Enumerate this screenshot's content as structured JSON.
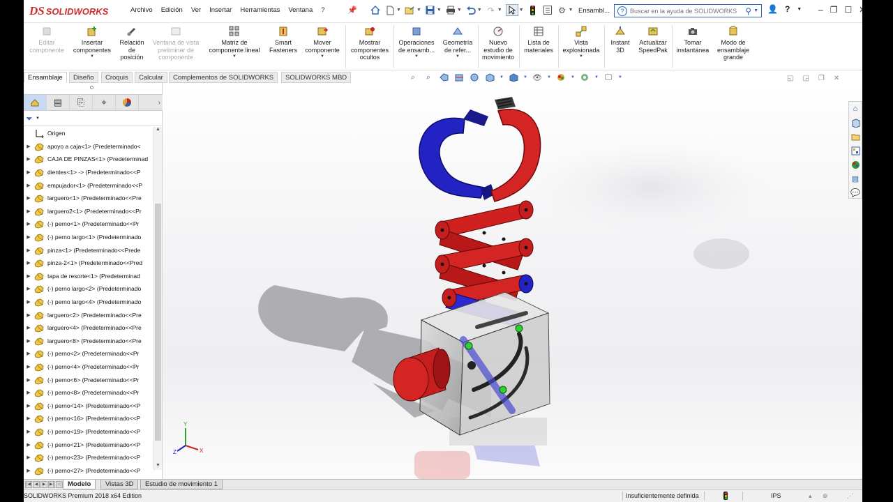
{
  "app": {
    "brand": "SOLIDWORKS",
    "ds_mark": "DS"
  },
  "menu": [
    "Archivo",
    "Edición",
    "Ver",
    "Insertar",
    "Herramientas",
    "Ventana",
    "?"
  ],
  "doc_title": "Ensambl...",
  "search": {
    "placeholder": "Buscar en la ayuda de SOLIDWORKS"
  },
  "commands": [
    {
      "label": "Editar\ncomponente",
      "icon": "edit-component-icon",
      "enabled": false
    },
    {
      "label": "Insertar\ncomponentes",
      "icon": "insert-components-icon",
      "enabled": true
    },
    {
      "label": "Relación\nde\nposición",
      "icon": "mate-icon",
      "enabled": true
    },
    {
      "label": "Ventana de vista\npreliminar de\ncomponente",
      "icon": "preview-window-icon",
      "enabled": false
    },
    {
      "label": "Matriz de\ncomponente lineal",
      "icon": "linear-pattern-icon",
      "enabled": true
    },
    {
      "label": "Smart\nFasteners",
      "icon": "smart-fasteners-icon",
      "enabled": true
    },
    {
      "label": "Mover\ncomponente",
      "icon": "move-component-icon",
      "enabled": true
    },
    {
      "label": "Mostrar\ncomponentes\nocultos",
      "icon": "show-hidden-icon",
      "enabled": true
    },
    {
      "label": "Operaciones\nde ensamb...",
      "icon": "assembly-features-icon",
      "enabled": true
    },
    {
      "label": "Geometría\nde refer...",
      "icon": "reference-geometry-icon",
      "enabled": true
    },
    {
      "label": "Nuevo\nestudio de\nmovimiento",
      "icon": "motion-study-icon",
      "enabled": true
    },
    {
      "label": "Lista de\nmateriales",
      "icon": "bom-icon",
      "enabled": true
    },
    {
      "label": "Vista\nexplosionada",
      "icon": "exploded-view-icon",
      "enabled": true
    },
    {
      "label": "Instant\n3D",
      "icon": "instant3d-icon",
      "enabled": true
    },
    {
      "label": "Actualizar\nSpeedPak",
      "icon": "speedpak-icon",
      "enabled": true
    },
    {
      "label": "Tomar\ninstantánea",
      "icon": "snapshot-icon",
      "enabled": true
    },
    {
      "label": "Modo de\nensamblaje\ngrande",
      "icon": "large-assembly-icon",
      "enabled": true
    }
  ],
  "tabs": [
    "Ensamblaje",
    "Diseño",
    "Croquis",
    "Calcular",
    "Complementos de SOLIDWORKS",
    "SOLIDWORKS MBD"
  ],
  "tree": {
    "origin": "Origen",
    "items": [
      "apoyo a caja<1> (Predeterminado<",
      "CAJA DE PINZAS<1> (Predeterminad",
      "dientes<1> -> (Predeterminado<<P",
      "empujador<1> (Predeterminado<<P",
      "larguero<1> (Predeterminado<<Pre",
      "larguero2<1> (Predeterminado<<Pr",
      "(-) perno<1> (Predeterminado<<Pr",
      "(-) perno largo<1> (Predeterminado",
      "pinza<1> (Predeterminado<<Prede",
      "pinza-2<1> (Predeterminado<<Pred",
      "tapa de resorte<1> (Predeterminad",
      "(-) perno largo<2> (Predeterminado",
      "(-) perno largo<4> (Predeterminado",
      "larguero<2> (Predeterminado<<Pre",
      "larguero<4> (Predeterminado<<Pre",
      "larguero<8> (Predeterminado<<Pre",
      "(-) perno<2> (Predeterminado<<Pr",
      "(-) perno<4> (Predeterminado<<Pr",
      "(-) perno<6> (Predeterminado<<Pr",
      "(-) perno<8> (Predeterminado<<Pr",
      "(-) perno<14> (Predeterminado<<P",
      "(-) perno<16> (Predeterminado<<P",
      "(-) perno<19> (Predeterminado<<P",
      "(-) perno<21> (Predeterminado<<P",
      "(-) perno<23> (Predeterminado<<P",
      "(-) perno<27> (Predeterminado<<P"
    ]
  },
  "bottom_tabs": [
    "Modelo",
    "Vistas 3D",
    "Estudio de movimiento 1"
  ],
  "status": {
    "edition": "SOLIDWORKS Premium 2018 x64 Edition",
    "definition": "Insuficientemente definida",
    "units": "IPS"
  },
  "colors": {
    "red": "#d42424",
    "blue": "#2424c8",
    "accent": "#2b66c0"
  }
}
